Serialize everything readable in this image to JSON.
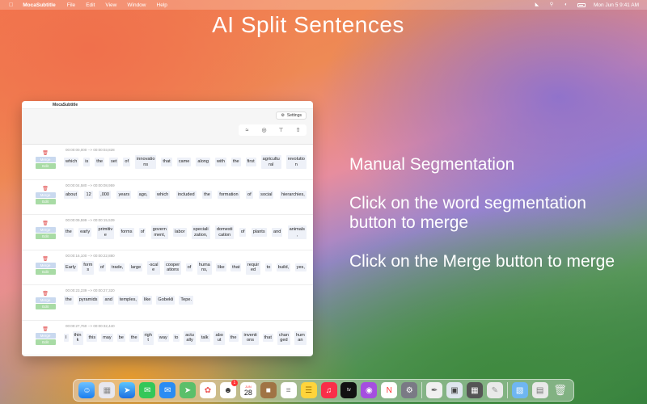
{
  "menubar": {
    "app_name": "MocaSubtitle",
    "menus": [
      "File",
      "Edit",
      "View",
      "Window",
      "Help"
    ],
    "clock": "Mon Jun 5  9:41 AM"
  },
  "headline": "AI Split Sentences",
  "window": {
    "title": "MocaSubtitle",
    "settings_label": "Settings",
    "merge_label": "Merge",
    "edit_label": "Edit",
    "rows": [
      {
        "time": "00:00:00,000 --> 00:00:03,828",
        "words": [
          "which",
          "is",
          "the",
          "set",
          "of",
          "innovatio\nns",
          "that",
          "came",
          "along",
          "with",
          "the",
          "first",
          "agricultu\nral",
          "revolutio\nn"
        ]
      },
      {
        "time": "00:00:04,580 --> 00:00:08,959",
        "words": [
          "about",
          "12",
          ",000",
          "years",
          "ago,",
          "which",
          "included",
          "the",
          "formation",
          "of",
          "social",
          "hierarchies,"
        ]
      },
      {
        "time": "00:00:09,599 --> 00:00:15,539",
        "words": [
          "the",
          "early",
          "primitiv\ne",
          "forms",
          "of",
          "govern\nment,",
          "labor",
          "speciali\nzation,",
          "domesti\ncation",
          "of",
          "plants",
          "and",
          "animals\n,"
        ]
      },
      {
        "time": "00:00:16,100 --> 00:00:22,880",
        "words": [
          "Early",
          "form\ns",
          "of",
          "trade,",
          "large",
          "-scal\ne",
          "cooper\nations",
          "of",
          "huma\nns,",
          "like",
          "that",
          "requir\ned",
          "to",
          "build,",
          "yes,"
        ]
      },
      {
        "time": "00:00:23,239 --> 00:00:27,320",
        "words": [
          "the",
          "pyramids",
          "and",
          "temples,",
          "like",
          "Gobekli",
          "Tepe."
        ]
      },
      {
        "time": "00:00:27,760 --> 00:00:32,440",
        "words": [
          "I",
          "thin\nk",
          "this",
          "may",
          "be",
          "the",
          "righ\nt",
          "way",
          "to",
          "actu\nally",
          "talk",
          "abo\nut",
          "the",
          "inventi\nons",
          "that",
          "chan\nged",
          "hum\nan"
        ]
      }
    ]
  },
  "instructions": [
    "Manual Segmentation",
    "Click on the word segmentation button to merge",
    "Click on the Merge button to merge"
  ],
  "dock": {
    "calendar_month": "JUN",
    "calendar_day": "28",
    "mail_badge": "1"
  },
  "colors": {
    "merge": "#c9d9ef",
    "edit": "#a8dba5",
    "trash": "#e04a4a",
    "word_bg": "#eef1f8"
  }
}
